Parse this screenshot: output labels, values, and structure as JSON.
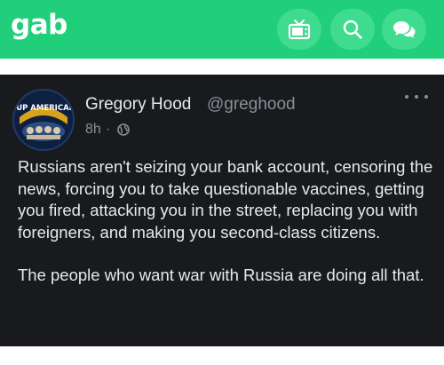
{
  "header": {
    "logo_text": "gab",
    "brand_color": "#21cf7a",
    "icons": [
      "tv-icon",
      "search-icon",
      "chat-icon"
    ]
  },
  "post": {
    "author": {
      "name": "Gregory Hood",
      "handle": "@greghood",
      "avatar_label": "WAKING UP AMERICAN DREAM"
    },
    "time": "8h",
    "separator": "·",
    "visibility_icon": "globe-icon",
    "menu_icon": "more-icon",
    "paragraphs": [
      "Russians aren't seizing your bank account, censoring the news, forcing you to take questionable vaccines, getting you fired, attacking you in the street, replacing you with foreigners, and making you second-class citizens.",
      "The people who want war with Russia are doing all that."
    ]
  }
}
